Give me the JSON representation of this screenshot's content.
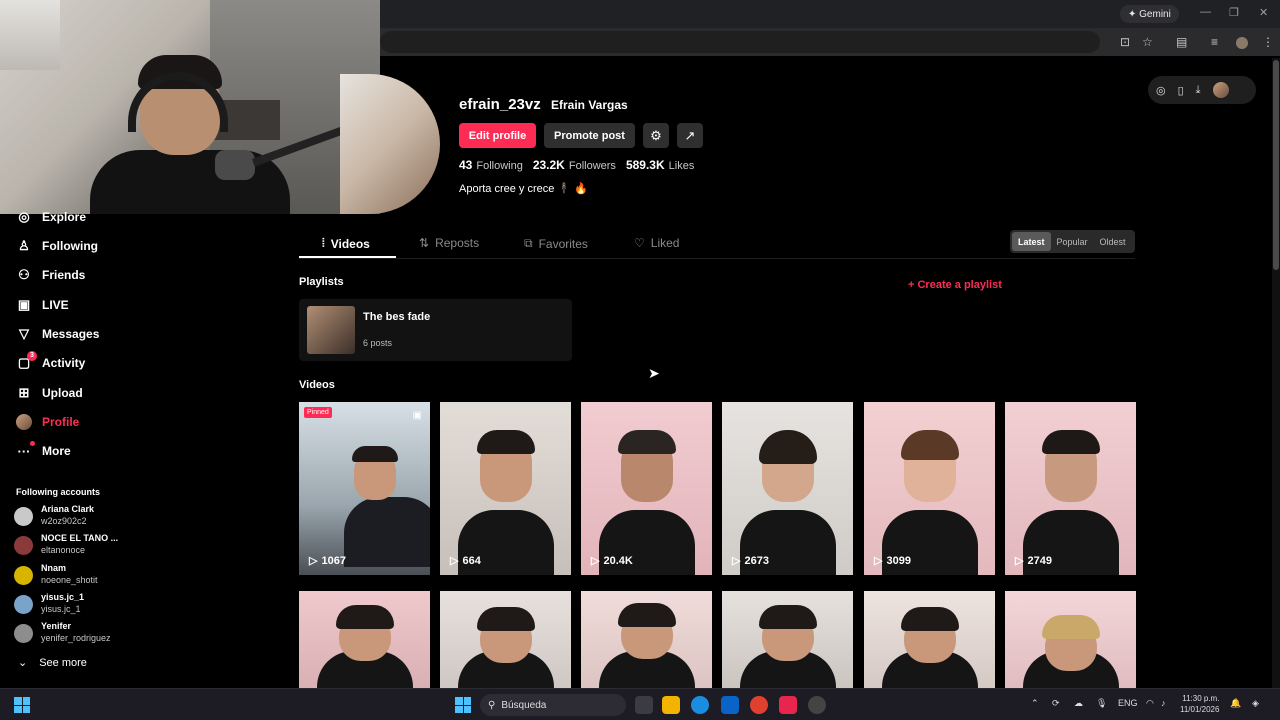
{
  "browser": {
    "gemini_label": "✦ Gemini",
    "minimize": "—",
    "restore": "❐",
    "close": "✕"
  },
  "sidebar": {
    "items": [
      {
        "label": "Explore",
        "icon": "explore-icon",
        "glyph": "◎"
      },
      {
        "label": "Following",
        "icon": "following-icon",
        "glyph": "♙"
      },
      {
        "label": "Friends",
        "icon": "friends-icon",
        "glyph": "⚇"
      },
      {
        "label": "LIVE",
        "icon": "live-icon",
        "glyph": "▣"
      },
      {
        "label": "Messages",
        "icon": "messages-icon",
        "glyph": "▽"
      },
      {
        "label": "Activity",
        "icon": "activity-icon",
        "glyph": "▢",
        "badge": "3"
      },
      {
        "label": "Upload",
        "icon": "upload-icon",
        "glyph": "⊞"
      },
      {
        "label": "Profile",
        "icon": "profile-avatar",
        "glyph": ""
      },
      {
        "label": "More",
        "icon": "more-icon",
        "glyph": "···"
      }
    ],
    "following_title": "Following accounts",
    "accounts": [
      {
        "name": "Ariana Clark",
        "handle": "w2oz902c2",
        "color": "#c9c9c9"
      },
      {
        "name": "NOCE EL TANO ...",
        "handle": "eltanonoce",
        "color": "#8a3a3a"
      },
      {
        "name": "Nnam",
        "handle": "noeone_shotit",
        "color": "#d8b400"
      },
      {
        "name": "yisus.jc_1",
        "handle": "yisus.jc_1",
        "color": "#7aa3c9"
      },
      {
        "name": "Yenifer",
        "handle": "yenifer_rodriguez",
        "color": "#8d8d8d"
      }
    ],
    "see_more": "See more",
    "see_more_glyph": "⌄"
  },
  "profile": {
    "username": "efrain_23vz",
    "display_name": "Efrain Vargas",
    "edit_label": "Edit profile",
    "promote_label": "Promote post",
    "settings_glyph": "⚙",
    "share_glyph": "↗",
    "following_count": "43",
    "following_label": "Following",
    "followers_count": "23.2K",
    "followers_label": "Followers",
    "likes_count": "589.3K",
    "likes_label": "Likes",
    "bio": "Aporta cree y crece 🕴️ 🔥"
  },
  "tabs": [
    {
      "label": "Videos",
      "glyph": "⦙"
    },
    {
      "label": "Reposts",
      "glyph": "⇅"
    },
    {
      "label": "Favorites",
      "glyph": "⧉"
    },
    {
      "label": "Liked",
      "glyph": "♡"
    }
  ],
  "sort": [
    "Latest",
    "Popular",
    "Oldest"
  ],
  "playlists_title": "Playlists",
  "create_playlist": "+ Create a playlist",
  "playlist": {
    "title": "The bes fade",
    "count": "6 posts"
  },
  "videos_title": "Videos",
  "videos_row1": [
    {
      "views": "1067",
      "pinned": "Pinned",
      "bg": "#cfd6dc"
    },
    {
      "views": "664",
      "bg": "#d6d0cb"
    },
    {
      "views": "20.4K",
      "bg": "#e8c4c8"
    },
    {
      "views": "2673",
      "bg": "#dedbd8"
    },
    {
      "views": "3099",
      "bg": "#ebc7c9"
    },
    {
      "views": "2749",
      "bg": "#e8c6ca"
    }
  ],
  "videos_row2": [
    {
      "bg": "#e4c0c4"
    },
    {
      "bg": "#ddd6d3"
    },
    {
      "bg": "#e8d4d2"
    },
    {
      "bg": "#dcd7d3"
    },
    {
      "bg": "#e6dcd8"
    },
    {
      "bg": "#ebcfd1"
    }
  ],
  "taskbar": {
    "search_label": "Búsqueda",
    "lang": "ENG",
    "time": "11:30 p.m.",
    "date": "11/01/2026"
  }
}
